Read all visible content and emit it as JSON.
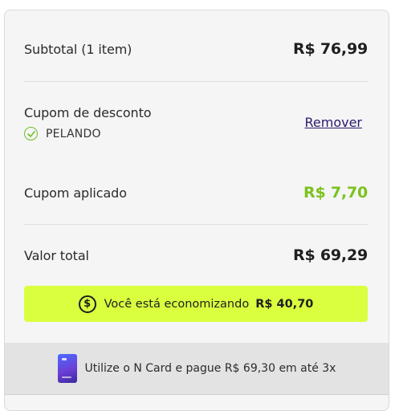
{
  "summary": {
    "subtotal_label": "Subtotal (1 item)",
    "subtotal_value": "R$ 76,99",
    "coupon_label": "Cupom de desconto",
    "coupon_code": "PELANDO",
    "remove_label": "Remover",
    "coupon_applied_label": "Cupom aplicado",
    "coupon_applied_value": "R$ 7,70",
    "total_label": "Valor total",
    "total_value": "R$ 69,29"
  },
  "savings": {
    "text": "Você está economizando",
    "amount": "R$ 40,70"
  },
  "ncard": {
    "text": "Utilize o N Card e pague R$ 69,30 em até 3x"
  },
  "colors": {
    "accent_green": "#7cc21e",
    "banner_lime": "#d9ff3f",
    "link_purple": "#2a1a6e"
  },
  "icons": [
    "check-circle-icon",
    "dollar-circle-icon",
    "ncard-icon"
  ]
}
